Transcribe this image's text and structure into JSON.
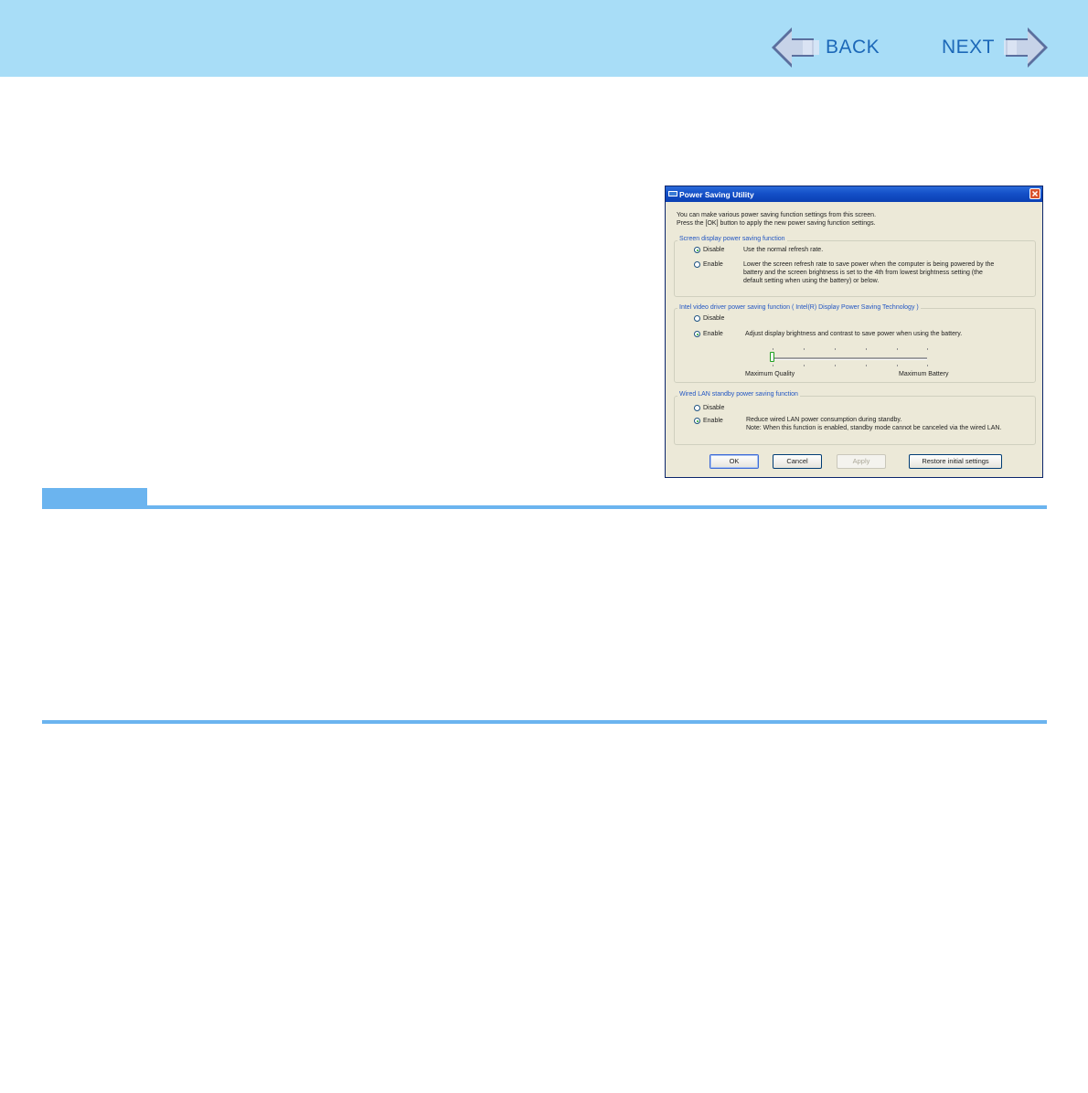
{
  "nav": {
    "back_label": "BACK",
    "next_label": "NEXT"
  },
  "dialog": {
    "title": "Power Saving Utility",
    "intro_line1": "You can make various power saving function settings from this screen.",
    "intro_line2": "Press the [OK] button to apply the new power saving function settings.",
    "screen_group": {
      "title": "Screen display power saving function",
      "disable_label": "Disable",
      "disable_desc": "Use the normal refresh rate.",
      "enable_label": "Enable",
      "enable_desc_line1": "Lower the screen refresh rate to save power when the computer is being powered by the",
      "enable_desc_line2": "battery and the screen brightness is set to the 4th from lowest brightness setting (the",
      "enable_desc_line3": "default setting when using the battery) or below.",
      "selected": "Disable"
    },
    "intel_group": {
      "title": "Intel video driver power saving function ( Intel(R) Display Power Saving Technology )",
      "disable_label": "Disable",
      "enable_label": "Enable",
      "enable_desc": "Adjust display brightness and contrast to save power when using the battery.",
      "slider_min_label": "Maximum Quality",
      "slider_max_label": "Maximum Battery",
      "slider_level": 0,
      "selected": "Enable"
    },
    "lan_group": {
      "title": "Wired LAN standby power saving function",
      "disable_label": "Disable",
      "enable_label": "Enable",
      "enable_desc_line1": "Reduce wired LAN power consumption during standby.",
      "enable_desc_line2": "Note: When this function is enabled, standby mode cannot be canceled via the wired LAN.",
      "selected": "Enable"
    },
    "buttons": {
      "ok": "OK",
      "cancel": "Cancel",
      "apply": "Apply",
      "restore": "Restore initial settings"
    }
  },
  "colors": {
    "header_bg": "#a8ddf7",
    "nav_text": "#1c68b8",
    "rule": "#6bb4ef"
  }
}
